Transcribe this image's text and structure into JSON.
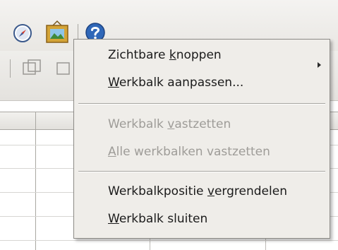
{
  "toolbar": {
    "icons": [
      "navigator-icon",
      "gallery-icon",
      "help-icon"
    ]
  },
  "context_menu": {
    "items": [
      {
        "pre": "Zichtbare ",
        "key": "k",
        "post": "noppen",
        "enabled": true,
        "submenu": true
      },
      {
        "pre": "",
        "key": "W",
        "post": "erkbalk aanpassen...",
        "enabled": true
      },
      {
        "pre": "Werkbalk ",
        "key": "v",
        "post": "astzetten",
        "enabled": false
      },
      {
        "pre": "",
        "key": "A",
        "post": "lle werkbalken vastzetten",
        "enabled": false
      },
      {
        "pre": "Werkbalkpositie ",
        "key": "v",
        "post": "ergrendelen",
        "enabled": true
      },
      {
        "pre": "",
        "key": "W",
        "post": "erkbalk sluiten",
        "enabled": true
      }
    ]
  }
}
